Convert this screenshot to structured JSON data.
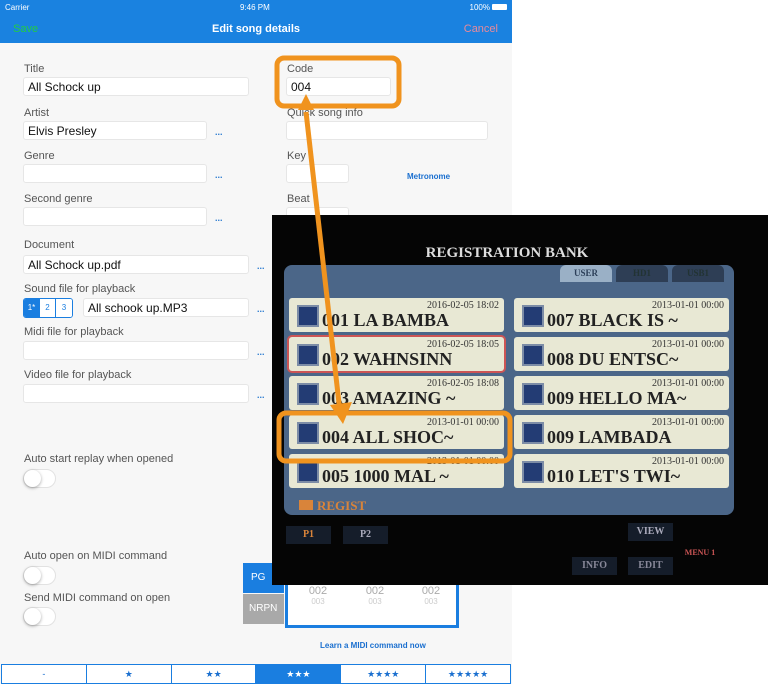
{
  "status": {
    "carrier": "Carrier",
    "time": "9:46 PM",
    "battery": "100%"
  },
  "nav": {
    "save": "Save",
    "title": "Edit song details",
    "cancel": "Cancel"
  },
  "form": {
    "title_label": "Title",
    "title_value": "All Schock up",
    "code_label": "Code",
    "code_value": "004",
    "artist_label": "Artist",
    "artist_value": "Elvis Presley",
    "quick_label": "Quick song info",
    "quick_value": "",
    "genre_label": "Genre",
    "key_label": "Key",
    "metronome": "Metronome",
    "second_genre_label": "Second genre",
    "beat_label": "Beat",
    "document_label": "Document",
    "document_value": "All Schock up.pdf",
    "sound_label": "Sound file for playback",
    "sound_tracks": [
      "1*",
      "2",
      "3"
    ],
    "sound_selected": 0,
    "sound_value": "All schook up.MP3",
    "midi_label": "Midi file for playback",
    "video_label": "Video file for playback",
    "more": "...",
    "auto_start_label": "Auto start replay when opened",
    "auto_start": false,
    "auto_open_label": "Auto open on MIDI command",
    "auto_open": false,
    "send_midi_label": "Send MIDI command on open",
    "send_midi": false,
    "midi_types": [
      "PG",
      "NRPN"
    ],
    "midi_type_selected": "PG",
    "picker_values": [
      "002",
      "002",
      "002"
    ],
    "picker_next": [
      "003",
      "003",
      "003"
    ],
    "learn": "Learn a MIDI command now"
  },
  "rating": {
    "options": [
      "-",
      "★",
      "★★",
      "★★★",
      "★★★★",
      "★★★★★"
    ],
    "selected": 3
  },
  "photo": {
    "title": "REGISTRATION BANK",
    "tabs": [
      "USER",
      "HD1",
      "USB1"
    ],
    "entries": [
      {
        "date": "2016-02-05 18:02",
        "name": "001 LA BAMBA"
      },
      {
        "date": "2016-02-05 18:05",
        "name": "002 WAHNSINN"
      },
      {
        "date": "2016-02-05 18:08",
        "name": "003 AMAZING ~"
      },
      {
        "date": "2013-01-01 00:00",
        "name": "004 ALL SHOC~"
      },
      {
        "date": "2013-01-01 00:00",
        "name": "005 1000 MAL ~"
      },
      {
        "date": "2013-01-01 00:00",
        "name": "007 BLACK IS ~"
      },
      {
        "date": "2013-01-01 00:00",
        "name": "008 DU ENTSC~"
      },
      {
        "date": "2013-01-01 00:00",
        "name": "009 HELLO MA~"
      },
      {
        "date": "2013-01-01 00:00",
        "name": "009 LAMBADA"
      },
      {
        "date": "2013-01-01 00:00",
        "name": "010 LET'S TWI~"
      }
    ],
    "folder": "REGIST",
    "p1": "P1",
    "p2": "P2",
    "view": "VIEW",
    "info": "INFO",
    "edit": "EDIT",
    "menu": "MENU 1"
  },
  "colors": {
    "accent": "#1a82e0",
    "highlight": "#f0931e"
  }
}
